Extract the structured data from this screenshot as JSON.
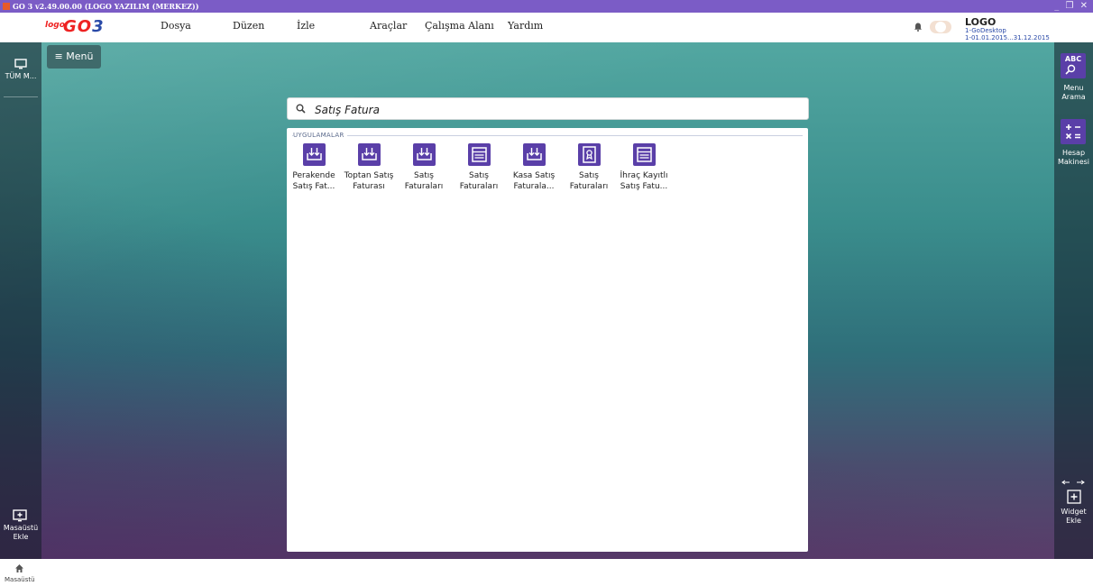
{
  "window": {
    "title": "GO 3 v2.49.00.00 (LOGO YAZILIM (MERKEZ))",
    "controls": "_ ❐ ✕"
  },
  "logo": {
    "small": "logo",
    "big_g": "GO",
    "big_n": "3"
  },
  "menubar": {
    "items": [
      "Dosya",
      "Düzen",
      "İzle",
      "Araçlar",
      "Çalışma Alanı",
      "Yardım"
    ]
  },
  "user": {
    "name": "LOGO",
    "line1": "1-GoDesktop",
    "line2": "1-01.01.2015...31.12.2015"
  },
  "left_rail": {
    "top_label": "TÜM M...",
    "bottom_label_1": "Masaüstü",
    "bottom_label_2": "Ekle"
  },
  "menu_button": {
    "label": "≡  Menü"
  },
  "right_rail": {
    "menu_search": [
      "Menu",
      "Arama"
    ],
    "calculator": [
      "Hesap",
      "Makinesi"
    ],
    "widget": [
      "Widget",
      "Ekle"
    ],
    "abc": "ABC"
  },
  "search": {
    "value": "Satış Fatura",
    "placeholder": ""
  },
  "results": {
    "section": "UYGULAMALAR",
    "apps": [
      {
        "line1": "Perakende",
        "line2": "Satış Fat...",
        "icon": "download-tray-icon"
      },
      {
        "line1": "Toptan Satış",
        "line2": "Faturası",
        "icon": "download-tray-icon"
      },
      {
        "line1": "Satış",
        "line2": "Faturaları",
        "icon": "download-tray-icon"
      },
      {
        "line1": "Satış",
        "line2": "Faturaları",
        "icon": "window-list-icon"
      },
      {
        "line1": "Kasa Satış",
        "line2": "Faturala...",
        "icon": "download-tray-icon"
      },
      {
        "line1": "Satış",
        "line2": "Faturaları",
        "icon": "certificate-icon"
      },
      {
        "line1": "İhraç Kayıtlı",
        "line2": "Satış Fatu...",
        "icon": "window-list-icon"
      }
    ]
  },
  "bottombar": {
    "home_label": "Masaüstü"
  },
  "colors": {
    "accent": "#5a3fa8",
    "titlebar": "#7b5cc6"
  }
}
